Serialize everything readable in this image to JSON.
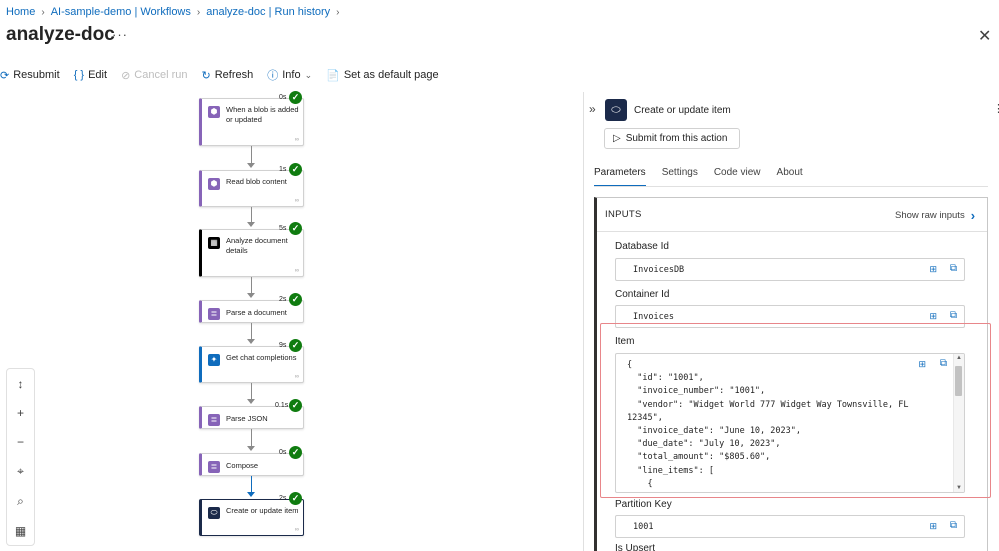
{
  "breadcrumb": [
    "Home",
    "AI-sample-demo | Workflows",
    "analyze-doc | Run history"
  ],
  "page_title": "analyze-doc",
  "toolbar": {
    "resubmit": "Resubmit",
    "edit": "Edit",
    "cancel_run": "Cancel run",
    "refresh": "Refresh",
    "info": "Info",
    "set_default": "Set as default page"
  },
  "workflow_steps": [
    {
      "label": "When a blob is added or updated",
      "duration": "0s",
      "status": "succeeded",
      "accent": "#8764b8"
    },
    {
      "label": "Read blob content",
      "duration": "1s",
      "status": "succeeded",
      "accent": "#8764b8"
    },
    {
      "label": "Analyze document details",
      "duration": "5s",
      "status": "succeeded",
      "accent": "#000000"
    },
    {
      "label": "Parse a document",
      "duration": "2s",
      "status": "succeeded",
      "accent": "#8764b8"
    },
    {
      "label": "Get chat completions",
      "duration": "9s",
      "status": "succeeded",
      "accent": "#0f6cbd"
    },
    {
      "label": "Parse JSON",
      "duration": "0.1s",
      "status": "succeeded",
      "accent": "#8764b8"
    },
    {
      "label": "Compose",
      "duration": "0s",
      "status": "succeeded",
      "accent": "#8764b8"
    },
    {
      "label": "Create or update item",
      "duration": "2s",
      "status": "succeeded",
      "accent": "#1b2a4a"
    }
  ],
  "panel": {
    "action_title": "Create or update item",
    "submit_label": "Submit from this action",
    "tabs": [
      "Parameters",
      "Settings",
      "Code view",
      "About"
    ],
    "active_tab": "Parameters",
    "inputs_header": "INPUTS",
    "show_raw": "Show raw inputs",
    "fields": {
      "database_id": {
        "label": "Database Id",
        "value": "InvoicesDB"
      },
      "container_id": {
        "label": "Container Id",
        "value": "Invoices"
      },
      "partition_key": {
        "label": "Partition Key",
        "value": "1001"
      },
      "next_label": "Is Upsert"
    },
    "item_label": "Item",
    "item_code": "{\n  \"id\": \"1001\",\n  \"invoice_number\": \"1001\",\n  \"vendor\": \"Widget World 777 Widget Way Townsville, FL\n12345\",\n  \"invoice_date\": \"June 10, 2023\",\n  \"due_date\": \"July 10, 2023\",\n  \"total_amount\": \"$805.60\",\n  \"line_items\": [\n    {"
  },
  "colors": {
    "link": "#0f6cbd",
    "success": "#107c10",
    "highlight": "#e8868a"
  },
  "icons": {
    "success": "checkmark-circle",
    "action": "cosmos-db-icon"
  }
}
